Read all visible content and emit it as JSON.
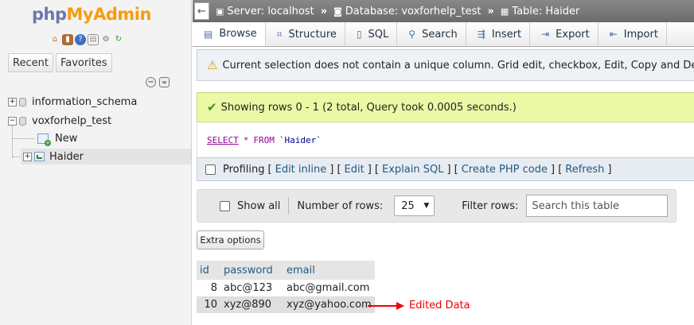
{
  "sidebar": {
    "logo_php": "php",
    "logo_myadmin": "MyAdmin",
    "quick_icons": [
      "home-icon",
      "logout-icon",
      "help-icon",
      "docs-icon",
      "settings-icon",
      "reload-icon"
    ],
    "tabs": {
      "recent": "Recent",
      "favorites": "Favorites"
    },
    "tree": {
      "db1": "information_schema",
      "db2": "voxforhelp_test",
      "new": "New",
      "table": "Haider"
    }
  },
  "topbar": {
    "back": "←",
    "server": "Server: localhost",
    "database": "Database: voxforhelp_test",
    "table": "Table: Haider",
    "sep": "»"
  },
  "tabs": [
    {
      "label": "Browse",
      "icon": "browse-icon"
    },
    {
      "label": "Structure",
      "icon": "structure-icon"
    },
    {
      "label": "SQL",
      "icon": "sql-icon"
    },
    {
      "label": "Search",
      "icon": "search-icon"
    },
    {
      "label": "Insert",
      "icon": "insert-icon"
    },
    {
      "label": "Export",
      "icon": "export-icon"
    },
    {
      "label": "Import",
      "icon": "import-icon"
    }
  ],
  "notice": "Current selection does not contain a unique column. Grid edit, checkbox, Edit, Copy and Delete features are not available.",
  "success": "Showing rows 0 - 1 (2 total, Query took 0.0005 seconds.)",
  "sql": {
    "select": "SELECT",
    "star": "*",
    "from": "FROM",
    "table": "`Haider`"
  },
  "profiling": {
    "label": "Profiling",
    "open": "[",
    "close": "]",
    "mid": "] [",
    "links": [
      "Edit inline",
      "Edit",
      "Explain SQL",
      "Create PHP code",
      "Refresh"
    ]
  },
  "navbar": {
    "show_all": "Show all",
    "num_rows_label": "Number of rows:",
    "num_rows_value": "25",
    "filter_label": "Filter rows:",
    "filter_placeholder": "Search this table"
  },
  "extra_options": "Extra options",
  "grid": {
    "columns": [
      "id",
      "password",
      "email"
    ],
    "rows": [
      [
        "8",
        "abc@123",
        "abc@gmail.com"
      ],
      [
        "10",
        "xyz@890",
        "xyz@yahoo.com"
      ]
    ]
  },
  "annotation": {
    "label": "Edited Data",
    "color": "#e00000"
  },
  "colors": {
    "link": "#235a81",
    "success_bg": "#ebf8a4",
    "notice_bg": "#eef1f5"
  }
}
